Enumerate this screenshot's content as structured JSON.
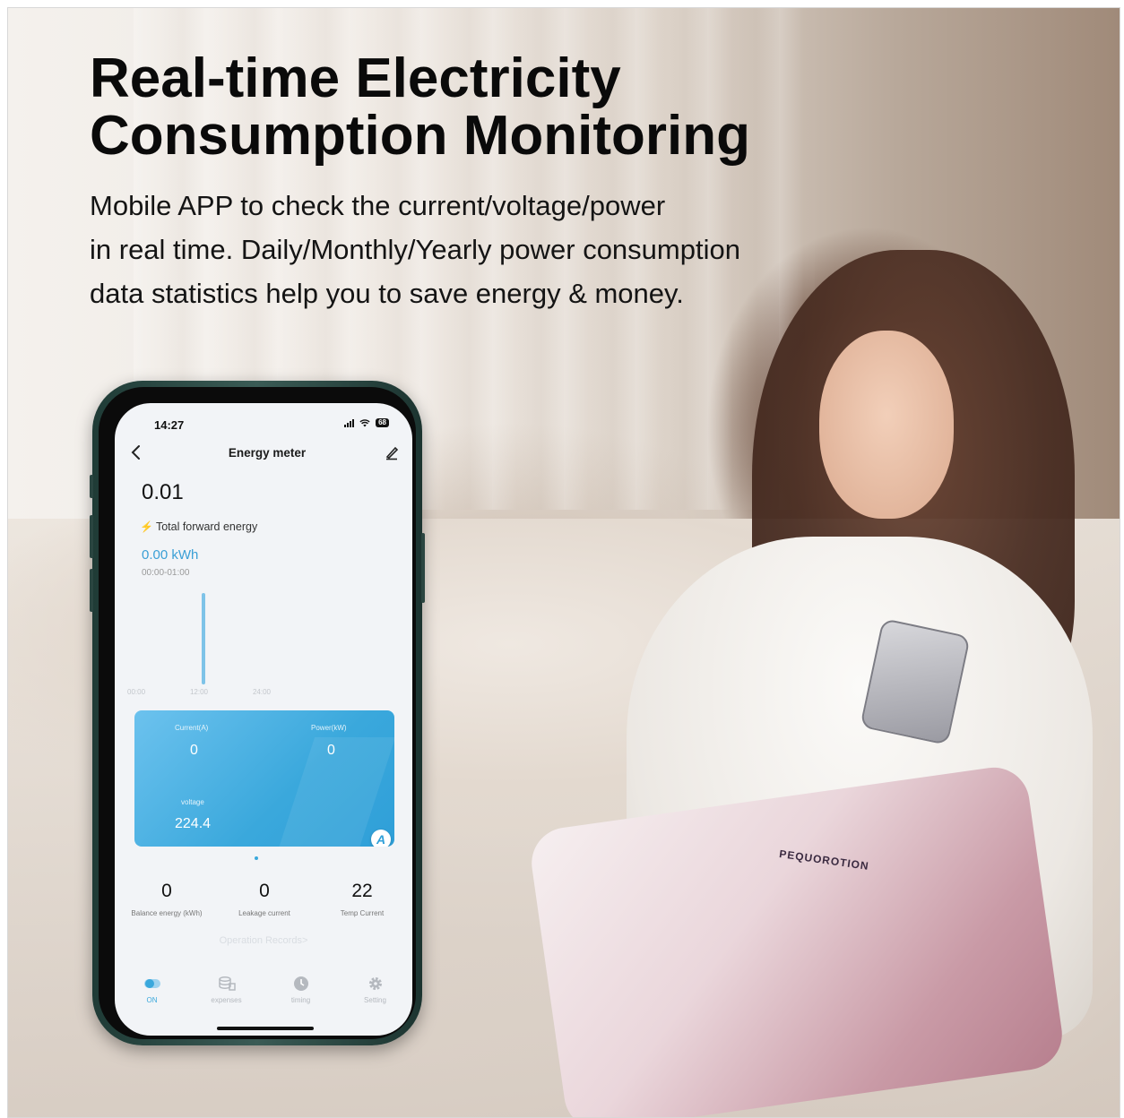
{
  "headline": {
    "line1": "Real-time Electricity",
    "line2": "Consumption Monitoring"
  },
  "subtext": {
    "line1": "Mobile APP to check the current/voltage/power",
    "line2": "in real time. Daily/Monthly/Yearly power consumption",
    "line3": "data statistics help you to save energy & money."
  },
  "pillow_text": "PEQUOROTION",
  "phone": {
    "status": {
      "time": "14:27",
      "battery": "68"
    },
    "nav": {
      "title": "Energy meter",
      "back_icon": "chevron-left-icon",
      "edit_icon": "edit-icon"
    },
    "total_value": "0.01",
    "energy_label": "Total forward energy",
    "kwh_value": "0.00",
    "kwh_unit": "kWh",
    "time_range": "00:00-01:00",
    "chart_ticks": [
      "00:00",
      "12:00",
      "24:00"
    ],
    "card": {
      "current_label": "Current(A)",
      "current_value": "0",
      "power_label": "Power(kW)",
      "power_value": "0",
      "voltage_label": "voltage",
      "voltage_value": "224.4",
      "badge": "A",
      "color_start": "#6cc2ee",
      "color_end": "#2f9fd8"
    },
    "stats": [
      {
        "value": "0",
        "label": "Balance energy (kWh)"
      },
      {
        "value": "0",
        "label": "Leakage current"
      },
      {
        "value": "22",
        "label": "Temp Current"
      }
    ],
    "records_link": "Operation Records>",
    "tabs": [
      {
        "label": "ON",
        "icon": "toggle-icon",
        "active": true
      },
      {
        "label": "expenses",
        "icon": "coins-icon",
        "active": false
      },
      {
        "label": "timing",
        "icon": "clock-icon",
        "active": false
      },
      {
        "label": "Setting",
        "icon": "gear-icon",
        "active": false
      }
    ],
    "accent_color": "#3aa8dc"
  }
}
